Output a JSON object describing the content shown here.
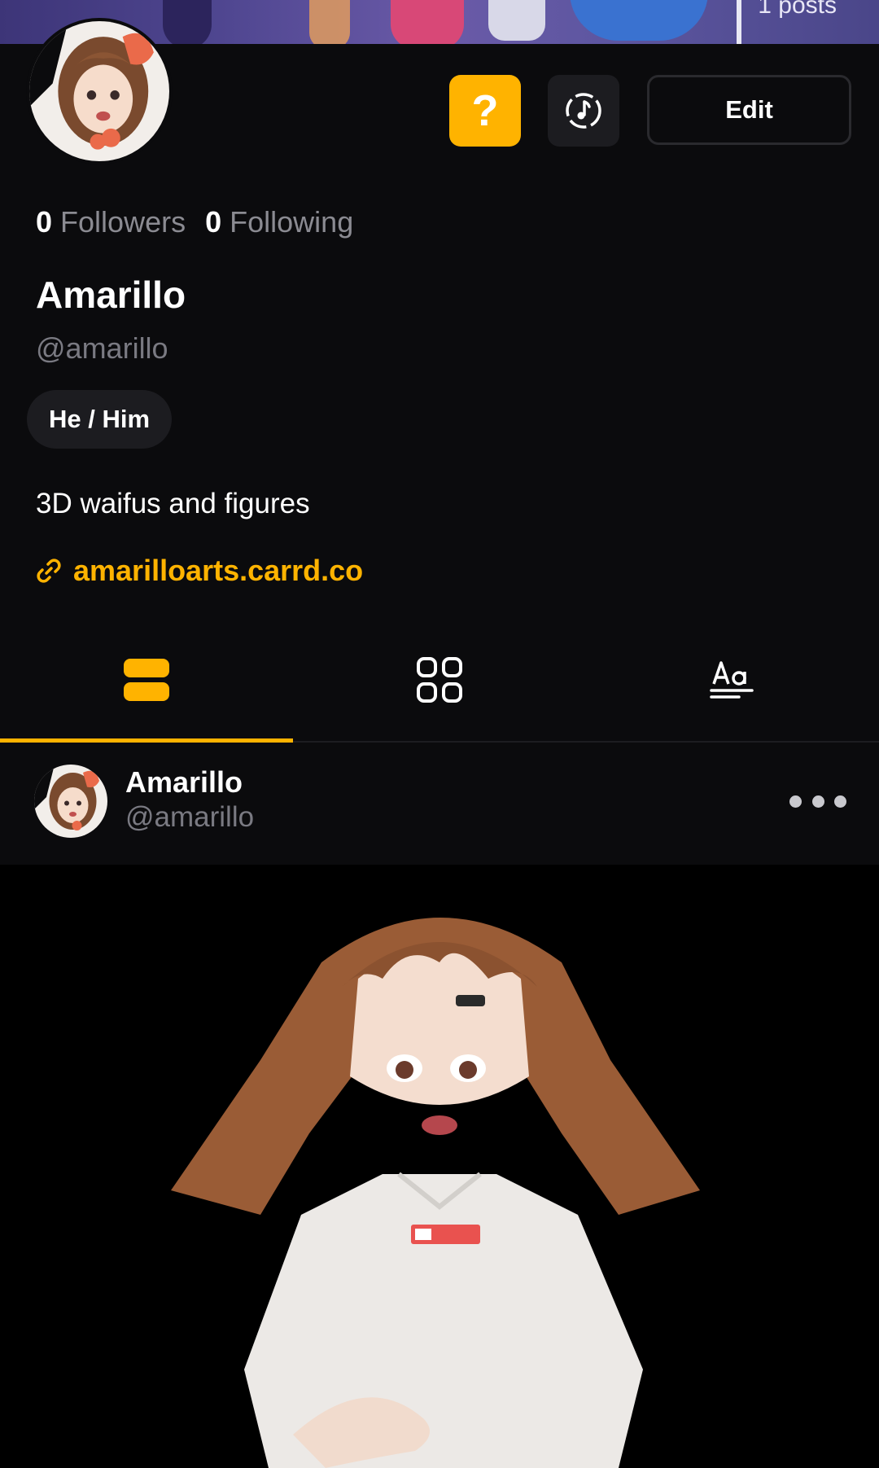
{
  "banner": {
    "posts_label": "1 posts"
  },
  "actions": {
    "help_label": "?",
    "edit_label": "Edit",
    "help_icon": "question-icon",
    "music_icon": "music-disc-icon"
  },
  "profile": {
    "followers_count": "0",
    "followers_label": "Followers",
    "following_count": "0",
    "following_label": "Following",
    "display_name": "Amarillo",
    "handle": "@amarillo",
    "pronouns": "He / Him",
    "bio": "3D waifus and figures",
    "link": "amarilloarts.carrd.co"
  },
  "tabs": [
    {
      "icon": "feed-list-icon",
      "active": true
    },
    {
      "icon": "grid-icon",
      "active": false
    },
    {
      "icon": "text-icon",
      "active": false
    }
  ],
  "post": {
    "author_name": "Amarillo",
    "author_handle": "@amarillo"
  },
  "colors": {
    "accent": "#ffb300",
    "background": "#0b0b0d",
    "muted": "#7a7a82"
  }
}
